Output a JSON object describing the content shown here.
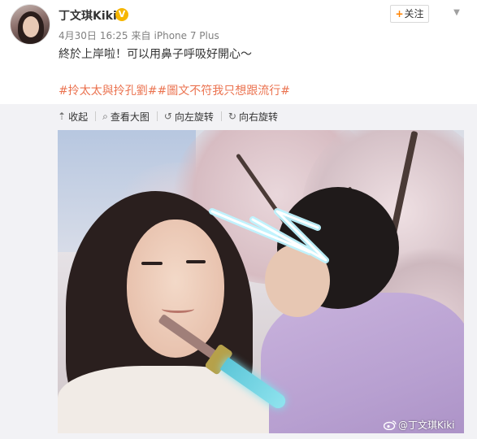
{
  "header": {
    "username": "丁文琪Kiki",
    "verified_badge": "V",
    "follow_label": "关注",
    "follow_plus": "+",
    "expand_icon": "chevron-down-icon"
  },
  "meta": {
    "date": "4月30日",
    "time": "16:25",
    "source_prefix": "来自",
    "source": "iPhone 7 Plus"
  },
  "post": {
    "text": "終於上岸啦！可以用鼻子呼吸好開心～",
    "tags": "#拎太太與拎孔劉##圖文不符我只想跟流行#"
  },
  "toolbar": {
    "collapse_label": "收起",
    "view_large_label": "查看大图",
    "rotate_left_label": "向左旋转",
    "rotate_right_label": "向右旋转"
  },
  "photo": {
    "watermark": "@丁文琪Kiki"
  },
  "colors": {
    "tag_color": "#eb7350",
    "verified_color": "#f6b600",
    "follow_plus_color": "#ff8200",
    "panel_bg": "#f2f2f5"
  }
}
